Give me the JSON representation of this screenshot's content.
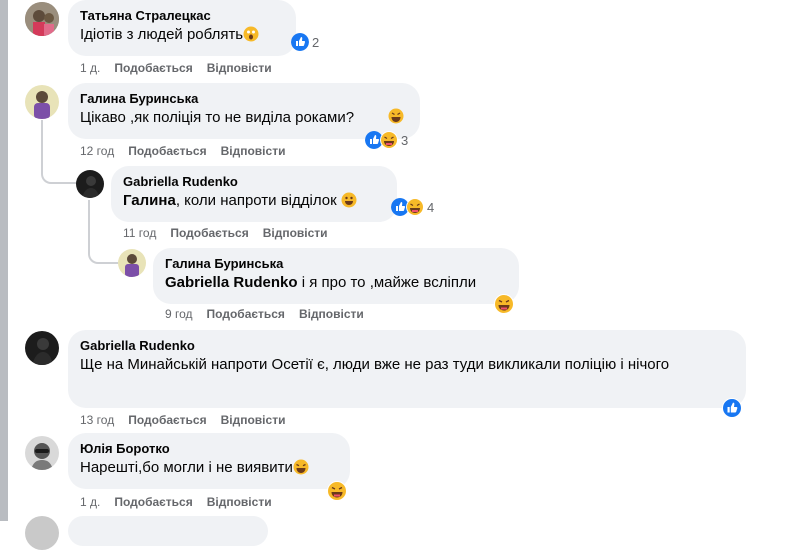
{
  "comments": [
    {
      "author": "Татьяна Стралецкас",
      "text": "Ідіотів з людей роблять",
      "reactions": {
        "count": "2"
      },
      "meta": {
        "time": "1 д.",
        "like": "Подобається",
        "reply": "Відповісти"
      }
    },
    {
      "author": "Галина Буринська",
      "text": "Цікаво ,як поліція то не виділа роками?",
      "reactions": {
        "count": "3"
      },
      "meta": {
        "time": "12 год",
        "like": "Подобається",
        "reply": "Відповісти"
      }
    },
    {
      "author": "Gabriella Rudenko",
      "mention": "Галина",
      "text": ", коли напроти відділок",
      "reactions": {
        "count": "4"
      },
      "meta": {
        "time": "11 год",
        "like": "Подобається",
        "reply": "Відповісти"
      }
    },
    {
      "author": "Галина Буринська",
      "mention": "Gabriella Rudenko",
      "text": " і я про то ,майже всліпли",
      "meta": {
        "time": "9 год",
        "like": "Подобається",
        "reply": "Відповісти"
      }
    },
    {
      "author": "Gabriella Rudenko",
      "text": "Ще на Минайській напроти Осетії є, люди вже не раз туди викликали поліцію і нічого",
      "meta": {
        "time": "13 год",
        "like": "Подобається",
        "reply": "Відповісти"
      }
    },
    {
      "author": "Юлія Боротко",
      "text": "Нарешті,бо могли і не виявити",
      "meta": {
        "time": "1 д.",
        "like": "Подобається",
        "reply": "Відповісти"
      }
    }
  ],
  "colors": {
    "bubble": "#f0f2f5",
    "meta": "#65676b",
    "like_blue": "#1877f2",
    "haha_yellow": "#f7b928"
  },
  "icons": [
    "like-reaction-icon",
    "haha-reaction-icon",
    "wow-reaction-icon",
    "grin-emoji-icon"
  ]
}
